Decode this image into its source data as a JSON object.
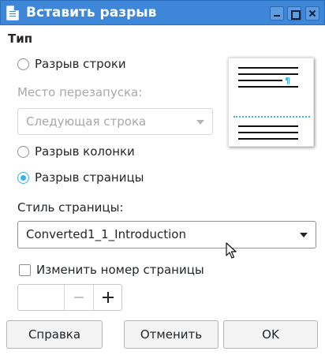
{
  "window": {
    "title": "Вставить разрыв"
  },
  "type_section": {
    "title": "Тип",
    "line_break_label": "Разрыв строки",
    "restart_place_label": "Место перезапуска:",
    "restart_place_value": "Следующая строка",
    "column_break_label": "Разрыв колонки",
    "page_break_label": "Разрыв страницы",
    "selected": "page_break"
  },
  "page_style": {
    "label": "Стиль страницы:",
    "value": "Converted1_1_Introduction"
  },
  "page_number": {
    "change_label": "Изменить номер страницы",
    "checked": false,
    "value": ""
  },
  "buttons": {
    "help": "Справка",
    "cancel": "Отменить",
    "ok": "OK"
  },
  "preview": {
    "paragraph_mark": "¶"
  },
  "colors": {
    "titlebar": "#3e87d8",
    "accent": "#3daee9"
  },
  "icons": {
    "app": "writer-document-icon",
    "minimize": "minimize-icon",
    "maximize": "maximize-icon",
    "close": "close-icon",
    "dropdown": "chevron-down-icon",
    "cursor": "mouse-pointer-icon"
  }
}
